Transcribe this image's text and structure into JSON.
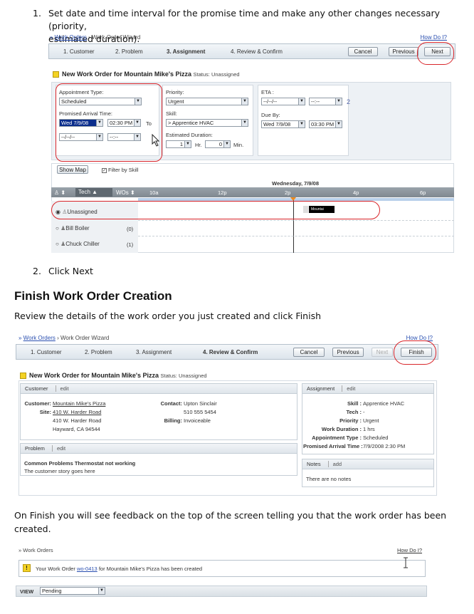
{
  "doc": {
    "step1_num": "1.",
    "step1_line1": "Set date and time interval for the promise time and make any other changes necessary (priority,",
    "step1_line2": "estimated duration).",
    "step2_num": "2.",
    "step2": "Click Next",
    "heading": "Finish Work Order Creation",
    "review_text": "Review the details of the work order you just created and click Finish",
    "finish_text_line1": "On Finish you will see feedback on the top of the screen telling you that the work order has been",
    "finish_text_line2": "created."
  },
  "shot1": {
    "crumb_link": "Work Orders",
    "crumb_rest": "› Work Order Wizard",
    "how_do_i": "How Do I?",
    "steps": [
      "1. Customer",
      "2. Problem",
      "3. Assignment",
      "4. Review & Confirm"
    ],
    "cancel": "Cancel",
    "previous": "Previous",
    "next": "Next",
    "title": "New Work Order for Mountain Mike's Pizza",
    "status": "Status: Unassigned",
    "appt_type_label": "Appointment Type:",
    "appt_type_value": "Scheduled",
    "promised_label": "Promised Arrival Time:",
    "date_value": "Wed 7/9/08",
    "time_value": "02:30 PM",
    "to": "To",
    "blank_date": "--/--/--",
    "blank_time": "--:--",
    "priority_label": "Priority:",
    "priority_value": "Urgent",
    "skill_label": "Skill:",
    "skill_value": "> Apprentice HVAC",
    "duration_label": "Estimated Duration:",
    "dur_hr": "1",
    "hr": "Hr.",
    "dur_min": "0",
    "min": "Min.",
    "eta_label": "ETA :",
    "eta_date": "--/--/--",
    "eta_time": "--:--",
    "eta_num": "2",
    "due_label": "Due By:",
    "due_date": "Wed 7/9/08",
    "due_time": "03:30 PM",
    "show_map": "Show Map",
    "filter": "Filter by Skill",
    "day": "Wednesday, 7/9/08",
    "col_tech": "Tech",
    "col_wos": "WOs",
    "hours": [
      "10a",
      "12p",
      "2p",
      "4p",
      "6p"
    ],
    "rows": [
      {
        "name": "Unassigned",
        "wos": ""
      },
      {
        "name": "Bill Boiler",
        "wos": "(0)"
      },
      {
        "name": "Chuck Chiller",
        "wos": "(1)"
      }
    ],
    "block_label": "Mountai"
  },
  "shot2": {
    "crumb_link": "Work Orders",
    "crumb_rest": "› Work Order Wizard",
    "how_do_i": "How Do I?",
    "steps": [
      "1. Customer",
      "2. Problem",
      "3. Assignment",
      "4. Review & Confirm"
    ],
    "cancel": "Cancel",
    "previous": "Previous",
    "next": "Next",
    "finish": "Finish",
    "title": "New Work Order for Mountain Mike's Pizza",
    "status": "Status: Unassigned",
    "customer_h": "Customer",
    "edit": "edit",
    "customer_label": "Customer:",
    "customer_value": "Mountain Mike's Pizza",
    "site_label": "Site:",
    "site_value": "410 W. Harder Road",
    "addr1": "410 W. Harder Road",
    "addr2": "Hayward, CA 94544",
    "contact_label": "Contact:",
    "contact_value": "Upton Sinclair",
    "phone": "510 555 5454",
    "billing_label": "Billing:",
    "billing_value": "Invoiceable",
    "problem_h": "Problem",
    "problem_title": "Common Problems Thermostat not working",
    "problem_story": "The customer story goes here",
    "assignment_h": "Assignment",
    "a_skill_l": "Skill :",
    "a_skill_v": "Apprentice HVAC",
    "a_tech_l": "Tech :",
    "a_tech_v": "-",
    "a_prio_l": "Priority :",
    "a_prio_v": "Urgent",
    "a_dur_l": "Work Duration :",
    "a_dur_v": "1 hrs",
    "a_type_l": "Appointment Type :",
    "a_type_v": "Scheduled",
    "a_prom_l": "Promised Arrival Time :",
    "a_prom_v": "7/9/2008 2:30 PM",
    "notes_h": "Notes",
    "add": "add",
    "no_notes": "There are no notes"
  },
  "shot3": {
    "crumb": "» Work Orders",
    "how_do_i": "How Do I?",
    "msg_pre": "Your Work Order ",
    "msg_link": "wo-0413",
    "msg_post": " for Mountain Mike's Pizza has been created",
    "view_label": "VIEW",
    "view_value": "Pending"
  }
}
